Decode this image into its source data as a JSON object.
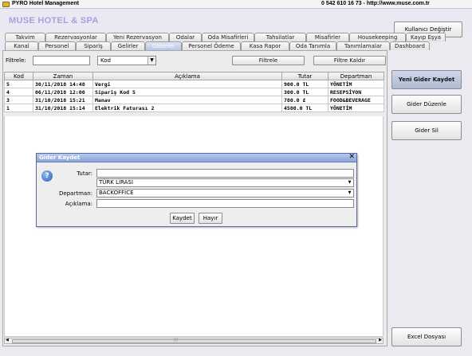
{
  "window": {
    "title": "PYRO Hotel Management",
    "contact": "0 542 610 16 73  -  http://www.muse.com.tr"
  },
  "header": {
    "brand": "MUSE HOTEL & SPA",
    "user_button": "Kullanıcı Değiştir"
  },
  "tabs": {
    "row1": [
      "Takvim",
      "Rezervasyonlar",
      "Yeni Rezervasyon",
      "Odalar",
      "Oda Misafirleri",
      "Tahsilatlar",
      "Misafirler",
      "Housekeeping",
      "Kayıp Eşya"
    ],
    "row2": [
      "Kanal",
      "Personel",
      "Sipariş",
      "Gelirler",
      "Giderler",
      "Personel Ödeme",
      "Kasa Rapor",
      "Oda Tanımla",
      "Tanımlamalar",
      "Dashboard"
    ],
    "active": "Giderler"
  },
  "filter": {
    "label": "Filtrele:",
    "value": "",
    "field": "Kod",
    "filter_button": "Filtrele",
    "clear_button": "Filtre Kaldır"
  },
  "table": {
    "columns": [
      "Kod",
      "Zaman",
      "Açıklama",
      "Tutar",
      "Departman"
    ],
    "rows": [
      [
        "5",
        "30/11/2018 14:48",
        "Vergi",
        "900.0 TL",
        "YÖNETİM"
      ],
      [
        "4",
        "06/11/2018 12:00",
        "Sipariş Kod 5",
        "300.0 TL",
        "RESEPSİYON"
      ],
      [
        "3",
        "31/10/2018 15:21",
        "Manav",
        "780.0 £",
        "FOOD&BEVERAGE"
      ],
      [
        "1",
        "31/10/2018 15:14",
        "Elektrik Faturası 2",
        "4500.0 TL",
        "YÖNETİM"
      ]
    ]
  },
  "side_buttons": {
    "new_expense": "Yeni Gider Kaydet",
    "edit_expense": "Gider Düzenle",
    "delete_expense": "Gider Sil",
    "excel": "Excel Dosyası"
  },
  "dialog": {
    "title": "Gider Kaydet",
    "close": "✕",
    "amount_label": "Tutar:",
    "amount_value": "",
    "currency": "TÜRK LİRASI",
    "department_label": "Departman:",
    "department": "BACKOFFICE",
    "description_label": "Açıklama:",
    "description_value": "",
    "save_button": "Kaydet",
    "cancel_button": "Hayır"
  },
  "colors": {
    "brand": "#a8a0dc",
    "dialog_title": "#8aa2d8",
    "active_tab": "#b8c6e4"
  },
  "icons": {
    "dialog": "question-icon",
    "window": "app-icon",
    "combo": "chevron-down-icon"
  }
}
